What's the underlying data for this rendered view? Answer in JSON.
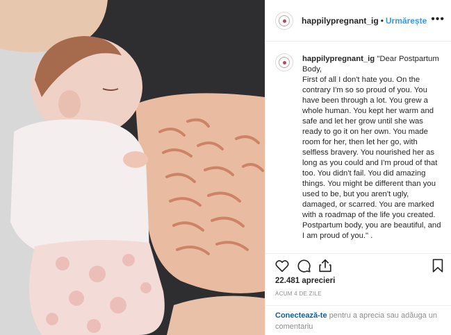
{
  "post": {
    "account": "happilypregnant_ig",
    "dot": "•",
    "follow_label": "Urmărește",
    "more_label": "•••",
    "caption": "\"Dear Postpartum Body,\nFirst of all I don't hate you. On the contrary I'm so so proud of you. You have been through a lot. You grew a whole human. You kept her warm and safe and let her grow until she was ready to go it on her own. You made room for her, then let her go, with selfless bravery. You nourished her as long as you could and I'm proud of that too. You didn't fail. You did amazing things. You might be different than you used to be, but you aren't ugly, damaged, or scarred. You are marked with a roadmap of the life you created. Postpartum body, you are beautiful, and I am proud of you.\" .",
    "likes": "22.481 aprecieri",
    "time_ago": "ACUM 4 DE ZILE",
    "login_link": "Conectează-te",
    "login_text": " pentru a aprecia sau adăuga un comentariu"
  },
  "icons": {
    "avatar": "brand-logo-icon",
    "like": "heart-icon",
    "comment": "comment-bubble-icon",
    "share": "share-icon",
    "save": "bookmark-icon",
    "more": "more-options-icon"
  },
  "colors": {
    "link": "#3897f0",
    "text": "#262626",
    "muted": "#8e8e8e",
    "border": "#efefef"
  }
}
